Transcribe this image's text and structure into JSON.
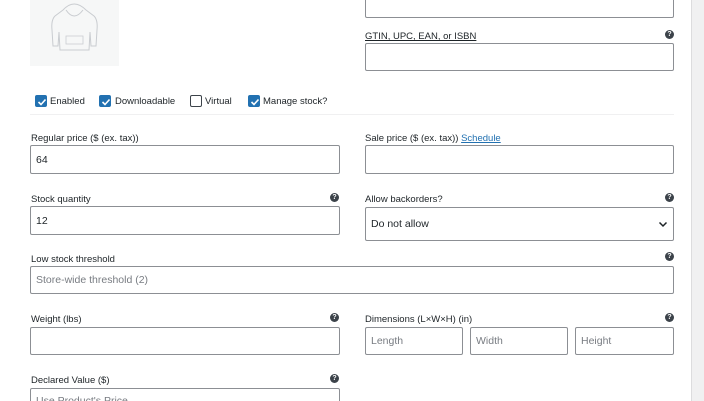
{
  "product_image": {
    "icon": "hoodie-icon"
  },
  "gtin": {
    "label": "GTIN, UPC, EAN, or ISBN",
    "value": ""
  },
  "checkboxes": [
    {
      "label": "Enabled",
      "checked": true
    },
    {
      "label": "Downloadable",
      "checked": true
    },
    {
      "label": "Virtual",
      "checked": false
    },
    {
      "label": "Manage stock?",
      "checked": true
    }
  ],
  "regular_price": {
    "label": "Regular price ($ (ex. tax))",
    "value": "64"
  },
  "sale_price": {
    "label": "Sale price ($ (ex. tax))",
    "link": "Schedule",
    "value": ""
  },
  "stock_quantity": {
    "label": "Stock quantity",
    "value": "12"
  },
  "backorders": {
    "label": "Allow backorders?",
    "selected": "Do not allow"
  },
  "low_stock": {
    "label": "Low stock threshold",
    "placeholder": "Store-wide threshold (2)"
  },
  "weight": {
    "label": "Weight (lbs)",
    "value": ""
  },
  "dimensions": {
    "label": "Dimensions (L×W×H) (in)",
    "length_placeholder": "Length",
    "width_placeholder": "Width",
    "height_placeholder": "Height"
  },
  "declared_value": {
    "label": "Declared Value ($)",
    "placeholder": "Use Product's Price"
  },
  "help_glyph": "?"
}
